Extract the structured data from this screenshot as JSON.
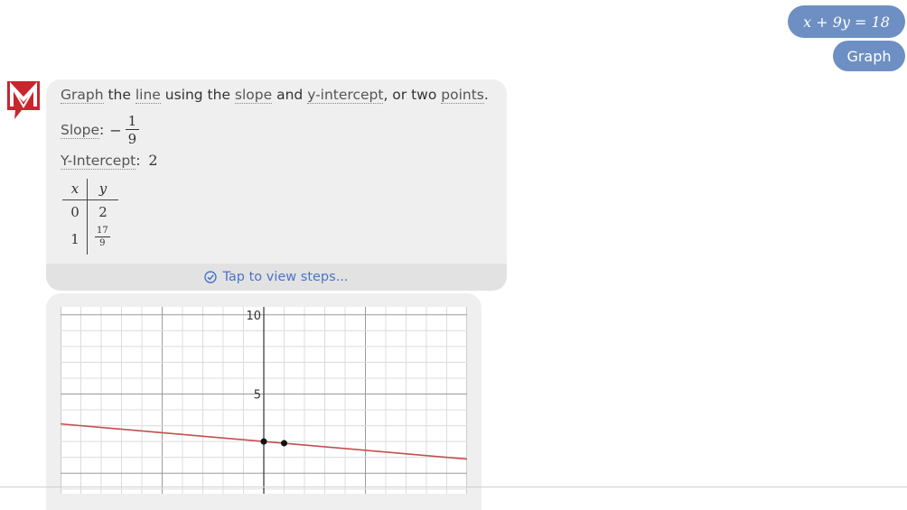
{
  "user": {
    "equation": "x + 9y = 18",
    "graph_label": "Graph"
  },
  "answer": {
    "intro": {
      "graph": "Graph",
      "the": " the ",
      "line": "line",
      "using": " using the ",
      "slope": "slope",
      "and": " and ",
      "yint": "y-intercept",
      "or": ", or two ",
      "points": "points",
      "end": "."
    },
    "slope_label": "Slope",
    "slope_sep": ":",
    "slope_sign": "−",
    "slope_num": "1",
    "slope_den": "9",
    "yint_label": "Y-Intercept",
    "yint_sep": ":",
    "yint_value": "2",
    "table": {
      "headers": [
        "x",
        "y"
      ],
      "rows": [
        {
          "x": "0",
          "y": "2"
        },
        {
          "x": "1",
          "y_num": "17",
          "y_den": "9"
        }
      ]
    },
    "steps_label": "Tap to view steps..."
  },
  "chart_data": {
    "type": "line",
    "equation": "x + 9y = 18",
    "xlim": [
      -10,
      10
    ],
    "ylim": [
      -1.3,
      10.5
    ],
    "grid_step": 1,
    "major_step": 5,
    "y_tick_labels": [
      "5",
      "10"
    ],
    "series": [
      {
        "x": [
          -10,
          10
        ],
        "y": [
          3.111,
          0.889
        ],
        "color": "#c0504d"
      }
    ],
    "points": [
      {
        "x": 0,
        "y": 2
      },
      {
        "x": 1,
        "y": 1.889
      }
    ]
  },
  "colors": {
    "bubble": "#6d8fc4",
    "logo": "#c8252c",
    "link": "#4a74c9",
    "line": "#c0504d"
  }
}
